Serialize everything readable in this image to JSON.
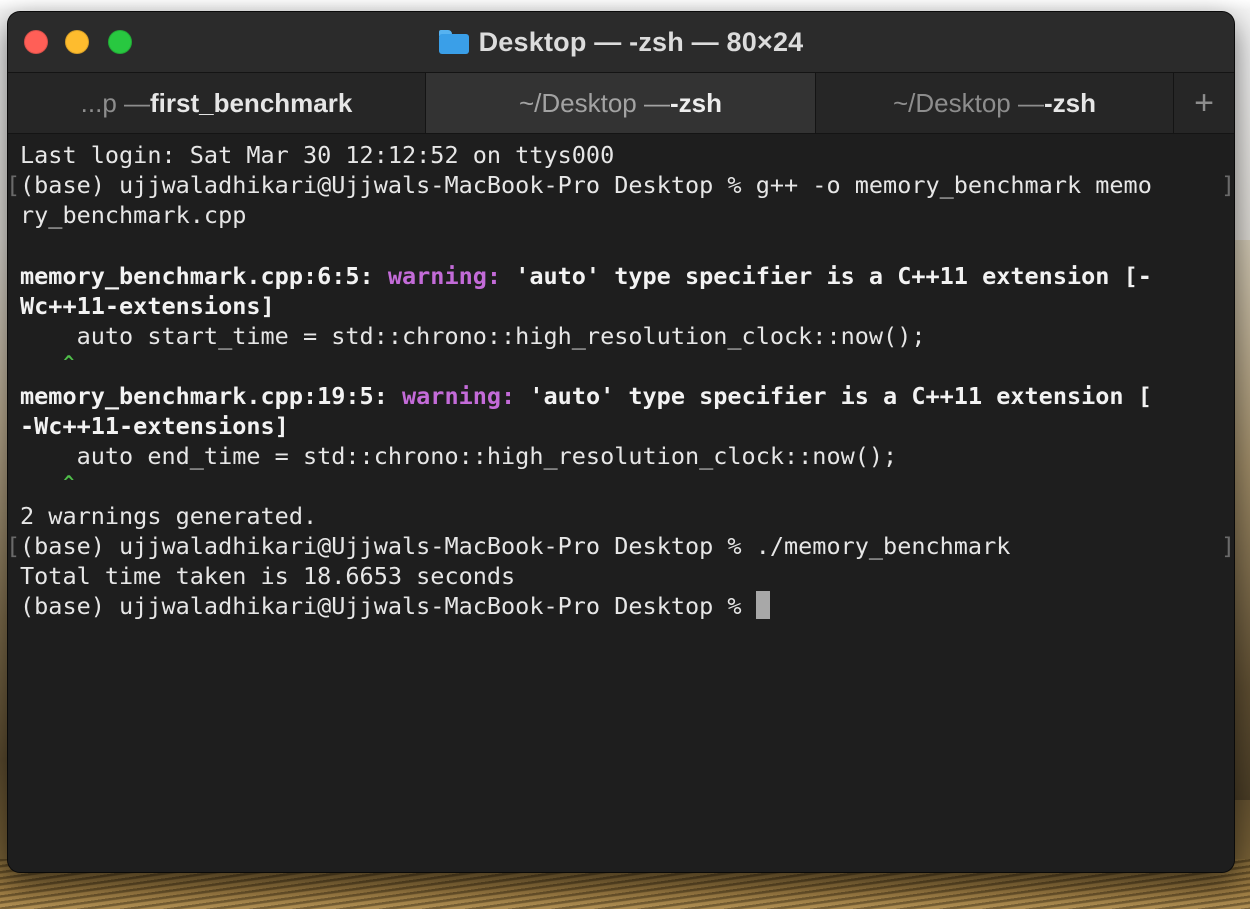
{
  "window": {
    "title": "Desktop — -zsh — 80×24",
    "folder_icon": "folder-icon",
    "colors": {
      "close": "#ff5f57",
      "minimize": "#febc2e",
      "zoom": "#28c840"
    }
  },
  "tabs": [
    {
      "prefix": "...p — ",
      "bold": "first_benchmark",
      "active": false
    },
    {
      "prefix": "~/Desktop — ",
      "bold": "-zsh",
      "active": true
    },
    {
      "prefix": "~/Desktop — ",
      "bold": "-zsh",
      "active": false
    }
  ],
  "new_tab_label": "+",
  "terminal": {
    "colors": {
      "warning": "#c36bd8",
      "caret": "#4fbf4a",
      "text": "#e6e6e6"
    },
    "lines": {
      "last_login": "Last login: Sat Mar 30 12:12:52 on ttys000",
      "cmd1_a": "(base) ujjwaladhikari@Ujjwals-MacBook-Pro Desktop % g++ -o memory_benchmark memo",
      "cmd1_b": "ry_benchmark.cpp",
      "w1_loc": "memory_benchmark.cpp:6:5: ",
      "w1_tag": "warning:",
      "w1_msg": " 'auto' type specifier is a C++11 extension [-",
      "w1_msg2": "Wc++11-extensions]",
      "w1_code": "    auto start_time = std::chrono::high_resolution_clock::now();",
      "w1_caret": "    ^",
      "w2_loc": "memory_benchmark.cpp:19:5: ",
      "w2_tag": "warning:",
      "w2_msg": " 'auto' type specifier is a C++11 extension [",
      "w2_msg2": "-Wc++11-extensions]",
      "w2_code": "    auto end_time = std::chrono::high_resolution_clock::now();",
      "w2_caret": "    ^",
      "summary": "2 warnings generated.",
      "cmd2": "(base) ujjwaladhikari@Ujjwals-MacBook-Pro Desktop % ./memory_benchmark",
      "output": "Total time taken is 18.6653 seconds",
      "prompt": "(base) ujjwaladhikari@Ujjwals-MacBook-Pro Desktop % "
    }
  }
}
